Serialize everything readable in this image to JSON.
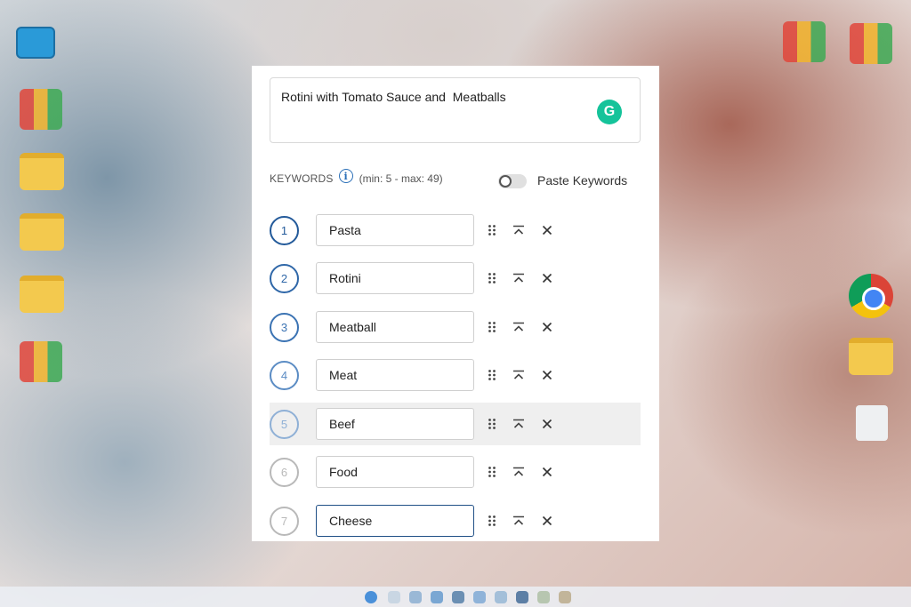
{
  "editor": {
    "title_value": "Rotini with Tomato Sauce and  Meatballs",
    "grammarly_glyph": "G"
  },
  "keywords": {
    "label": "KEYWORDS",
    "info_glyph": "i",
    "range": "(min: 5 - max: 49)",
    "toggle_label": "Paste Keywords",
    "toggle_on": false,
    "items": [
      {
        "num": "1",
        "value": "Pasta",
        "ring_color": "#235a9a"
      },
      {
        "num": "2",
        "value": "Rotini",
        "ring_color": "#2f67a8"
      },
      {
        "num": "3",
        "value": "Meatball",
        "ring_color": "#3b73b3"
      },
      {
        "num": "4",
        "value": "Meat",
        "ring_color": "#5b8cc4"
      },
      {
        "num": "5",
        "value": "Beef",
        "ring_color": "#8fb0d6"
      },
      {
        "num": "6",
        "value": "Food",
        "ring_color": "#b9b9b9"
      },
      {
        "num": "7",
        "value": "Cheese",
        "ring_color": "#b9b9b9"
      }
    ]
  },
  "colors": {
    "accent": "#235a9a",
    "grammarly": "#15c39a",
    "row_hover": "#efefef"
  }
}
